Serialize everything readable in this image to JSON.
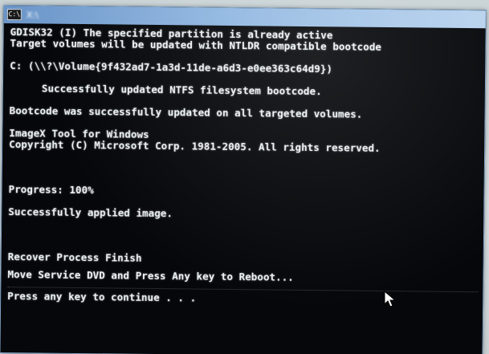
{
  "window": {
    "title_prefix": "X:\\"
  },
  "console": {
    "lines": [
      "GDISK32 (I) The specified partition is already active",
      "Target volumes will be updated with NTLDR compatible bootcode",
      "C: (\\\\?\\Volume{9f432ad7-1a3d-11de-a6d3-e0ee363c64d9})",
      "Successfully updated NTFS filesystem bootcode.",
      "Bootcode was successfully updated on all targeted volumes.",
      "ImageX Tool for Windows",
      "Copyright (C) Microsoft Corp. 1981-2005. All rights reserved.",
      "Progress: 100%",
      "Successfully applied image.",
      "Recover Process Finish",
      "Move Service DVD and Press Any key to Reboot...",
      "Press any key to continue . . ."
    ]
  },
  "colors": {
    "console_background": "#05070a",
    "console_text": "#eef3f6",
    "titlebar_start": "#6b95c8",
    "titlebar_end": "#b9d3ee"
  },
  "icons": {
    "app": "command-prompt-icon",
    "pointer": "mouse-pointer-icon"
  }
}
